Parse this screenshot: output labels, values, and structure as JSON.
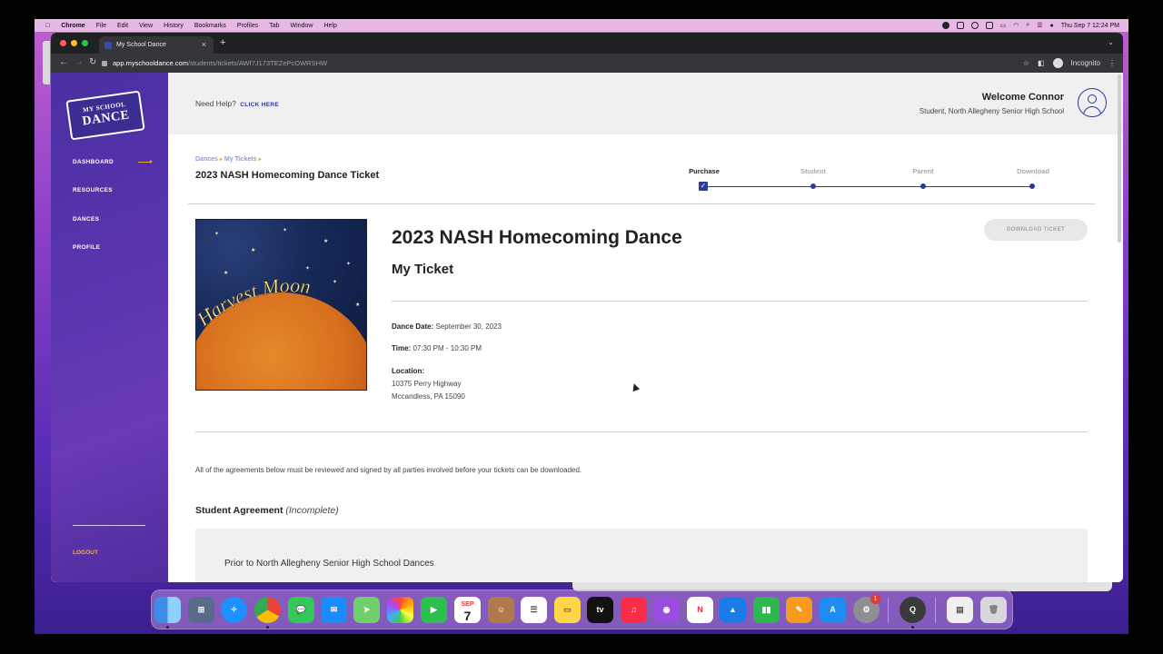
{
  "menubar": {
    "app": "Chrome",
    "items": [
      "File",
      "Edit",
      "View",
      "History",
      "Bookmarks",
      "Profiles",
      "Tab",
      "Window",
      "Help"
    ],
    "clock": "Thu Sep 7  12:24 PM"
  },
  "browser": {
    "tab_title": "My School Dance",
    "url_host": "app.myschooldance.com",
    "url_path": "/students/tickets/AWf7J173TEZePcOWRSHW",
    "incognito_label": "Incognito"
  },
  "sidebar": {
    "logo_line1": "MY SCHOOL",
    "logo_line2": "DANCE",
    "items": [
      {
        "label": "DASHBOARD"
      },
      {
        "label": "RESOURCES"
      },
      {
        "label": "DANCES"
      },
      {
        "label": "PROFILE"
      }
    ],
    "logout": "LOGOUT"
  },
  "header": {
    "help_text": "Need Help?",
    "help_link": "CLICK HERE",
    "welcome": "Welcome Connor",
    "role": "Student, North Allegheny Senior High School"
  },
  "breadcrumb": {
    "items": [
      "Dances",
      "My Tickets"
    ],
    "separator": "▸"
  },
  "page_title": "2023 NASH Homecoming Dance Ticket",
  "stepper": {
    "steps": [
      "Purchase",
      "Student",
      "Parent",
      "Download"
    ],
    "current_step": "Purchase",
    "check": "✓"
  },
  "event": {
    "poster_text": "Harvest Moon",
    "title": "2023 NASH Homecoming Dance",
    "subtitle": "My Ticket",
    "download_button": "DOWNLOAD TICKET",
    "date_label": "Dance Date:",
    "date_value": "September 30, 2023",
    "time_label": "Time:",
    "time_value": "07:30 PM - 10:30 PM",
    "location_label": "Location:",
    "address_line1": "10375 Perry Highway",
    "address_line2": "Mccandless, PA 15090"
  },
  "notice": "All of the agreements below must be reviewed and signed by all parties involved before your tickets can be downloaded.",
  "student_agreement": {
    "title": "Student Agreement",
    "status": "(Incomplete)",
    "text": "Prior to North Allegheny Senior High School Dances"
  },
  "dock": {
    "calendar_month": "SEP",
    "calendar_day": "7",
    "tv_label": "tv",
    "settings_badge": "1"
  },
  "colors": {
    "accent": "#2a3b9c",
    "sidebar": "#5a35b0",
    "logout": "#f0b030"
  }
}
